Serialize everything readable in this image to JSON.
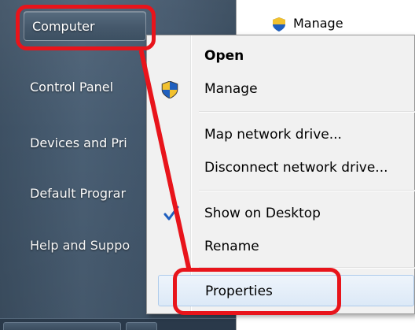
{
  "start_menu": {
    "items": [
      {
        "label": "Computer"
      },
      {
        "label": "Control Panel"
      },
      {
        "label": "Devices and Pri"
      },
      {
        "label": "Default Prograr"
      },
      {
        "label": "Help and Suppo"
      }
    ]
  },
  "background_window": {
    "item_label": "Manage"
  },
  "context_menu": {
    "items": {
      "open": "Open",
      "manage": "Manage",
      "map_network_drive": "Map network drive...",
      "disconnect_network_drive": "Disconnect network drive...",
      "show_on_desktop": "Show on Desktop",
      "rename": "Rename",
      "properties": "Properties"
    },
    "show_on_desktop_checked": true
  },
  "colors": {
    "annotation": "#e8141b",
    "hover_bg": "#dce9f7",
    "check": "#1f5fbf"
  },
  "icons": [
    "uac-shield-icon",
    "checkmark-icon"
  ]
}
